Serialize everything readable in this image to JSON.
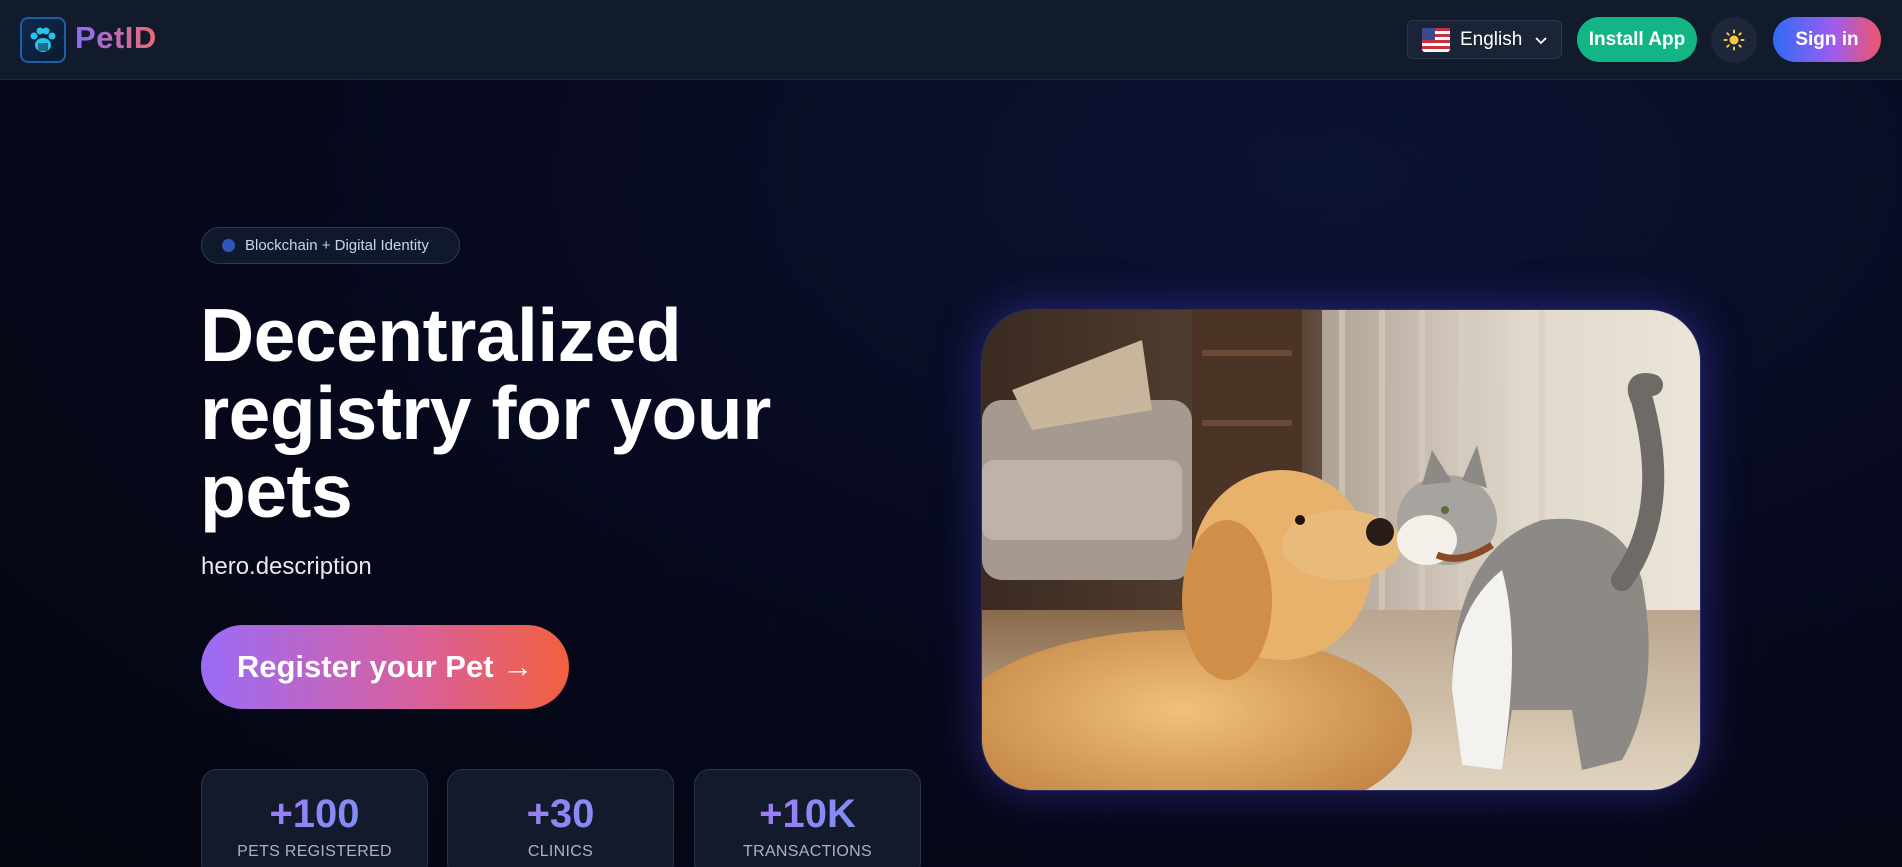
{
  "header": {
    "app_name": "PetID",
    "language": "English",
    "install_label": "Install App",
    "signin_label": "Sign in"
  },
  "hero": {
    "badge": "Blockchain + Digital Identity",
    "title": "Decentralized registry for your pets",
    "description": "hero.description",
    "cta_label": "Register your Pet →",
    "image_alt": "Golden retriever and cat touching noses"
  },
  "stats": [
    {
      "value": "+100",
      "label": "PETS REGISTERED"
    },
    {
      "value": "+30",
      "label": "CLINICS"
    },
    {
      "value": "+10K",
      "label": "TRANSACTIONS"
    }
  ],
  "colors": {
    "brand_gradient_start": "#8b6cff",
    "brand_gradient_end": "#f06b6b",
    "install_green": "#13b585",
    "background": "#070a1f"
  },
  "icons": {
    "logo": "paw-icon",
    "flag": "us-flag-icon",
    "chevron": "chevron-down-icon",
    "theme": "sun-icon"
  }
}
